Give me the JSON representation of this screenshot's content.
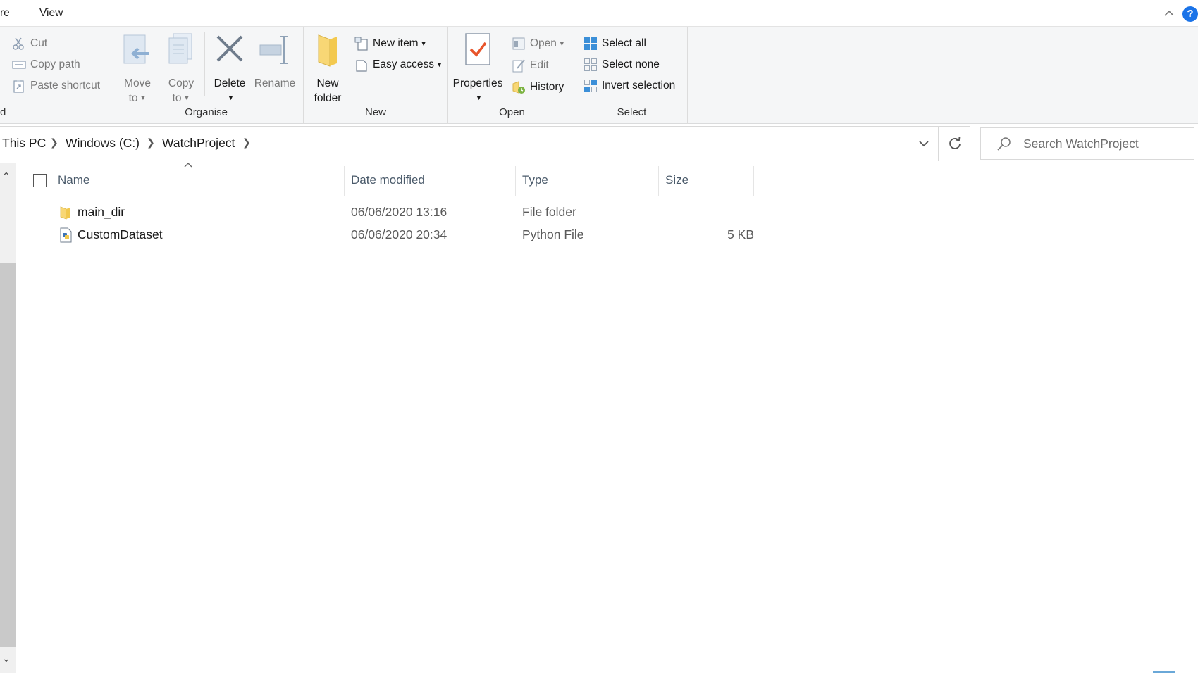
{
  "menubar": {
    "tabs": [
      "re",
      "View"
    ]
  },
  "ribbon": {
    "clipboard": {
      "cut": "Cut",
      "copy_path": "Copy path",
      "paste_shortcut": "Paste shortcut",
      "partial_label": "d"
    },
    "organise": {
      "label": "Organise",
      "move_to": [
        "Move",
        "to"
      ],
      "copy_to": [
        "Copy",
        "to"
      ],
      "delete": "Delete",
      "rename": "Rename"
    },
    "new": {
      "label": "New",
      "new_folder": [
        "New",
        "folder"
      ],
      "new_item": "New item",
      "easy_access": "Easy access"
    },
    "open": {
      "label": "Open",
      "properties": "Properties",
      "open": "Open",
      "edit": "Edit",
      "history": "History"
    },
    "select": {
      "label": "Select",
      "select_all": "Select all",
      "select_none": "Select none",
      "invert_selection": "Invert selection"
    }
  },
  "address": {
    "breadcrumbs": [
      "This PC",
      "Windows (C:)",
      "WatchProject"
    ]
  },
  "search": {
    "placeholder": "Search WatchProject"
  },
  "columns": {
    "name": "Name",
    "date_modified": "Date modified",
    "type": "Type",
    "size": "Size"
  },
  "files": [
    {
      "name": "main_dir",
      "date": "06/06/2020 13:16",
      "type": "File folder",
      "size": "",
      "icon": "folder-icon"
    },
    {
      "name": "CustomDataset",
      "date": "06/06/2020 20:34",
      "type": "Python File",
      "size": "5 KB",
      "icon": "python-file-icon"
    }
  ],
  "colors": {
    "accent": "#1a73e8",
    "ribbon_bg": "#f5f6f7",
    "folder_yellow": "#f8d775"
  }
}
